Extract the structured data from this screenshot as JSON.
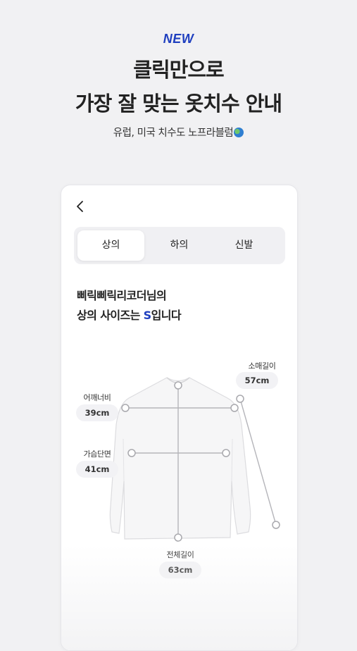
{
  "hero": {
    "badge": "NEW",
    "headline_line1": "클릭만으로",
    "headline_line2": "가장 잘 맞는 옷치수 안내",
    "subtitle": "유럽, 미국 치수도 노프라블럼"
  },
  "card": {
    "tabs": [
      {
        "label": "상의",
        "active": true
      },
      {
        "label": "하의",
        "active": false
      },
      {
        "label": "신발",
        "active": false
      }
    ],
    "message": {
      "line1": "삐릭삐릭리코더님의",
      "line2_prefix": "상의 사이즈는 ",
      "line2_size": "S",
      "line2_suffix": "입니다"
    },
    "measurements": [
      {
        "label": "소매길이",
        "value": "57cm"
      },
      {
        "label": "어깨너비",
        "value": "39cm"
      },
      {
        "label": "가슴단면",
        "value": "41cm"
      },
      {
        "label": "전체길이",
        "value": "63cm"
      }
    ]
  },
  "colors": {
    "accent": "#1f3fbf",
    "background": "#f1f1f3",
    "card": "#ffffff"
  }
}
